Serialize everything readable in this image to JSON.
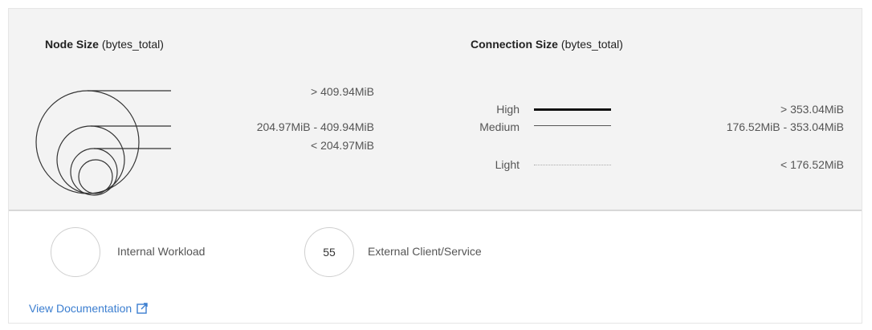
{
  "node_size": {
    "title": "Node Size",
    "subtitle": "(bytes_total)",
    "tiers": [
      {
        "label": "> 409.94MiB"
      },
      {
        "label": "204.97MiB - 409.94MiB"
      },
      {
        "label": "< 204.97MiB"
      }
    ]
  },
  "connection_size": {
    "title": "Connection Size",
    "subtitle": "(bytes_total)",
    "tiers": [
      {
        "name": "High",
        "label": "> 353.04MiB"
      },
      {
        "name": "Medium",
        "label": "176.52MiB - 353.04MiB"
      },
      {
        "name": "Light",
        "label": "< 176.52MiB"
      }
    ]
  },
  "node_types": [
    {
      "circle_text": "",
      "label": "Internal Workload"
    },
    {
      "circle_text": "55",
      "label": "External Client/Service"
    }
  ],
  "documentation_link": {
    "label": "View Documentation",
    "icon": "external-link-icon"
  },
  "colors": {
    "link": "#3b7ed0",
    "panel": "#f3f3f3"
  }
}
